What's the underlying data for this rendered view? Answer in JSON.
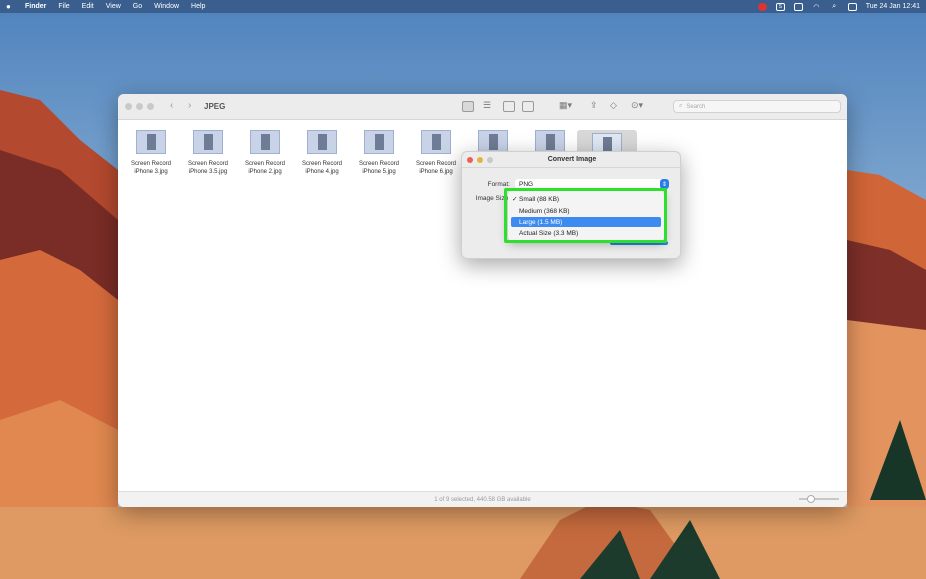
{
  "menubar": {
    "app_name": "Finder",
    "items": [
      "File",
      "Edit",
      "View",
      "Go",
      "Window",
      "Help"
    ],
    "status_icons": [
      "creative-cloud-icon",
      "scrivener-icon",
      "battery-icon",
      "wifi-icon",
      "spotlight-search-icon",
      "control-center-icon"
    ],
    "clock": "Tue 24 Jan  12:41"
  },
  "finder": {
    "title": "JPEG",
    "search_placeholder": "Search",
    "files": [
      {
        "name": "Screen Record\niPhone 3.jpg"
      },
      {
        "name": "Screen Record\niPhone 3.5.jpg"
      },
      {
        "name": "Screen Record\niPhone 2.jpg"
      },
      {
        "name": "Screen Record\niPhone 4.jpg"
      },
      {
        "name": "Screen Record\niPhone 5.jpg"
      },
      {
        "name": "Screen Record\niPhone 6.jpg"
      },
      {
        "name": ""
      },
      {
        "name": ""
      },
      {
        "name": ""
      }
    ],
    "status": "1 of 9 selected, 440.58 GB available"
  },
  "dialog": {
    "title": "Convert Image",
    "format_label": "Format:",
    "format_value": "PNG",
    "image_size_label": "Image Size:",
    "size_options": [
      {
        "label": "Small (88 KB)",
        "checked": true
      },
      {
        "label": "Medium (368 KB)",
        "checked": false
      },
      {
        "label": "Large (1.5 MB)",
        "checked": false
      },
      {
        "label": "Actual Size (3.3 MB)",
        "checked": false
      }
    ],
    "check_mark": "✓",
    "highlighted_option": "Large (1.5 MB)"
  },
  "colors": {
    "highlight_box": "#2de02d",
    "selection_blue": "#3d8bf0",
    "menubar": "#3a5f8f"
  }
}
